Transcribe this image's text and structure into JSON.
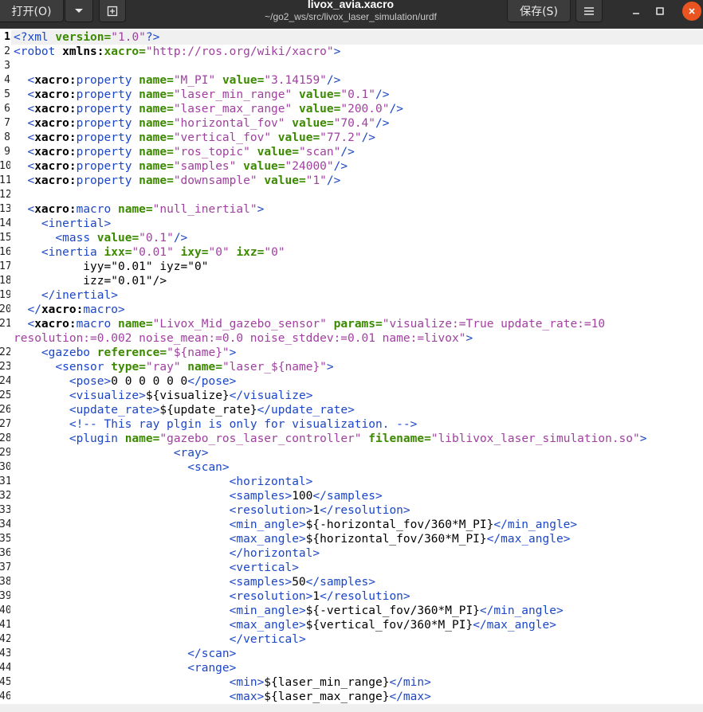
{
  "window": {
    "title": "livox_avia.xacro",
    "subtitle": "~/go2_ws/src/livox_laser_simulation/urdf"
  },
  "toolbar": {
    "open_label": "打开(O)",
    "open_dropdown_icon": "chevron-down-icon",
    "new_tab_icon": "new-document-icon",
    "save_label": "保存(S)",
    "menu_icon": "hamburger-menu-icon"
  },
  "window_controls": {
    "minimize_icon": "minimize-icon",
    "maximize_icon": "maximize-icon",
    "close_icon": "close-icon"
  },
  "colors": {
    "titlebar": "#2f2f2f",
    "close_button": "#e95420",
    "tag": "#1b46c8",
    "attribute": "#3b8a00",
    "string": "#a040a0",
    "prefix": "#000000",
    "current_line": "#f0f0f0"
  },
  "editor": {
    "current_line": 1,
    "lines": [
      {
        "n": "1",
        "t": "<?xml version=\"1.0\"?>"
      },
      {
        "n": "2",
        "t": "<robot xmlns:xacro=\"http://ros.org/wiki/xacro\">"
      },
      {
        "n": "3",
        "t": ""
      },
      {
        "n": "4",
        "t": "  <xacro:property name=\"M_PI\" value=\"3.14159\"/>"
      },
      {
        "n": "5",
        "t": "  <xacro:property name=\"laser_min_range\" value=\"0.1\"/>"
      },
      {
        "n": "6",
        "t": "  <xacro:property name=\"laser_max_range\" value=\"200.0\"/>"
      },
      {
        "n": "7",
        "t": "  <xacro:property name=\"horizontal_fov\" value=\"70.4\"/>"
      },
      {
        "n": "8",
        "t": "  <xacro:property name=\"vertical_fov\" value=\"77.2\"/>"
      },
      {
        "n": "9",
        "t": "  <xacro:property name=\"ros_topic\" value=\"scan\"/>"
      },
      {
        "n": "10",
        "t": "  <xacro:property name=\"samples\" value=\"24000\"/>"
      },
      {
        "n": "11",
        "t": "  <xacro:property name=\"downsample\" value=\"1\"/>"
      },
      {
        "n": "12",
        "t": ""
      },
      {
        "n": "13",
        "t": "  <xacro:macro name=\"null_inertial\">"
      },
      {
        "n": "14",
        "t": "    <inertial>"
      },
      {
        "n": "15",
        "t": "      <mass value=\"0.1\"/>"
      },
      {
        "n": "16",
        "t": "    <inertia ixx=\"0.01\" ixy=\"0\" ixz=\"0\""
      },
      {
        "n": "17",
        "t": "          iyy=\"0.01\" iyz=\"0\""
      },
      {
        "n": "18",
        "t": "          izz=\"0.01\"/>"
      },
      {
        "n": "19",
        "t": "    </inertial>"
      },
      {
        "n": "20",
        "t": "  </xacro:macro>"
      },
      {
        "n": "21",
        "t": "  <xacro:macro name=\"Livox_Mid_gazebo_sensor\" params=\"visualize:=True update_rate:=10"
      },
      {
        "n": "",
        "t": "resolution:=0.002 noise_mean:=0.0 noise_stddev:=0.01 name:=livox\">"
      },
      {
        "n": "22",
        "t": "    <gazebo reference=\"${name}\">"
      },
      {
        "n": "23",
        "t": "      <sensor type=\"ray\" name=\"laser_${name}\">"
      },
      {
        "n": "24",
        "t": "        <pose>0 0 0 0 0 0</pose>"
      },
      {
        "n": "25",
        "t": "        <visualize>${visualize}</visualize>"
      },
      {
        "n": "26",
        "t": "        <update_rate>${update_rate}</update_rate>"
      },
      {
        "n": "27",
        "t": "        <!-- This ray plgin is only for visualization. -->"
      },
      {
        "n": "28",
        "t": "        <plugin name=\"gazebo_ros_laser_controller\" filename=\"liblivox_laser_simulation.so\">"
      },
      {
        "n": "29",
        "t": "                       <ray>"
      },
      {
        "n": "30",
        "t": "                         <scan>"
      },
      {
        "n": "31",
        "t": "                               <horizontal>"
      },
      {
        "n": "32",
        "t": "                               <samples>100</samples>"
      },
      {
        "n": "33",
        "t": "                               <resolution>1</resolution>"
      },
      {
        "n": "34",
        "t": "                               <min_angle>${-horizontal_fov/360*M_PI}</min_angle>"
      },
      {
        "n": "35",
        "t": "                               <max_angle>${horizontal_fov/360*M_PI}</max_angle>"
      },
      {
        "n": "36",
        "t": "                               </horizontal>"
      },
      {
        "n": "37",
        "t": "                               <vertical>"
      },
      {
        "n": "38",
        "t": "                               <samples>50</samples>"
      },
      {
        "n": "39",
        "t": "                               <resolution>1</resolution>"
      },
      {
        "n": "40",
        "t": "                               <min_angle>${-vertical_fov/360*M_PI}</min_angle>"
      },
      {
        "n": "41",
        "t": "                               <max_angle>${vertical_fov/360*M_PI}</max_angle>"
      },
      {
        "n": "42",
        "t": "                               </vertical>"
      },
      {
        "n": "43",
        "t": "                         </scan>"
      },
      {
        "n": "44",
        "t": "                         <range>"
      },
      {
        "n": "45",
        "t": "                               <min>${laser_min_range}</min>"
      },
      {
        "n": "46",
        "t": "                               <max>${laser_max_range}</max>"
      }
    ]
  }
}
